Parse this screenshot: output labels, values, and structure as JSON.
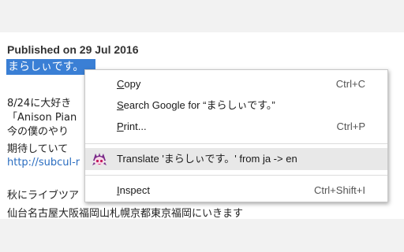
{
  "post": {
    "published": "Published on 29 Jul 2016",
    "selected_text": "まらしぃです。",
    "lines": [
      "8/24に大好き",
      "「Anison Pian",
      "今の僕のやり",
      "期待していて",
      "http://subcul-r",
      "秋にライブツア",
      "仙台名古屋大阪福岡山札幌京都東京福岡にいきます"
    ]
  },
  "context_menu": {
    "copy": {
      "first": "C",
      "rest": "opy",
      "shortcut": "Ctrl+C"
    },
    "search": {
      "first": "S",
      "rest": "earch Google for “まらしぃです。”"
    },
    "print": {
      "first": "P",
      "rest": "rint...",
      "shortcut": "Ctrl+P"
    },
    "translate": {
      "label": "Translate 'まらしぃです。' from ja -> en",
      "icon": "anime-girl-extension-icon"
    },
    "inspect": {
      "first": "I",
      "pre": "",
      "rest": "nspect",
      "shortcut": "Ctrl+Shift+I"
    }
  },
  "colors": {
    "selection": "#3a7fd5",
    "link": "#2a6dc0",
    "highlight_row": "#e8e8e8"
  }
}
